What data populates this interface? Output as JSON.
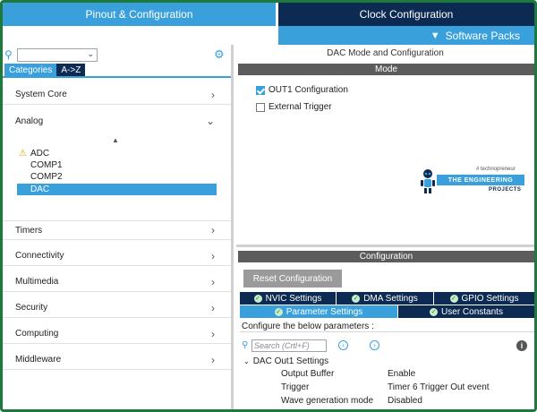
{
  "top_tabs": {
    "pinout": "Pinout & Configuration",
    "clock": "Clock Configuration"
  },
  "software_packs": {
    "label": "Software Packs",
    "chevron": "chevron-down-icon"
  },
  "left": {
    "search_value": "",
    "tabs": {
      "categories": "Categories",
      "az": "A->Z"
    },
    "categories": [
      {
        "label": "System Core",
        "expanded": false
      },
      {
        "label": "Analog",
        "expanded": true
      },
      {
        "label": "Timers",
        "expanded": false
      },
      {
        "label": "Connectivity",
        "expanded": false
      },
      {
        "label": "Multimedia",
        "expanded": false
      },
      {
        "label": "Security",
        "expanded": false
      },
      {
        "label": "Computing",
        "expanded": false
      },
      {
        "label": "Middleware",
        "expanded": false
      }
    ],
    "analog_items": [
      {
        "label": "ADC",
        "warning": true,
        "selected": false
      },
      {
        "label": "COMP1",
        "warning": false,
        "selected": false
      },
      {
        "label": "COMP2",
        "warning": false,
        "selected": false
      },
      {
        "label": "DAC",
        "warning": false,
        "selected": true
      }
    ]
  },
  "right": {
    "title": "DAC Mode and Configuration",
    "mode_band": "Mode",
    "mode_options": [
      {
        "label": "OUT1 Configuration",
        "checked": true
      },
      {
        "label": "External Trigger",
        "checked": false
      }
    ],
    "logo": {
      "tagline": "# technopreneur",
      "banner": "THE ENGINEERING",
      "subtitle": "PROJECTS"
    },
    "configuration_band": "Configuration",
    "reset_button": "Reset Configuration",
    "tabs_row1": [
      {
        "label": "NVIC Settings"
      },
      {
        "label": "DMA Settings"
      },
      {
        "label": "GPIO Settings"
      }
    ],
    "tabs_row2": [
      {
        "label": "Parameter Settings",
        "active": true
      },
      {
        "label": "User Constants",
        "active": false
      }
    ],
    "configure_text": "Configure the below parameters :",
    "search_placeholder": "Search (Crtl+F)",
    "group_title": "DAC Out1 Settings",
    "params": [
      {
        "name": "Output Buffer",
        "value": "Enable"
      },
      {
        "name": "Trigger",
        "value": "Timer 6 Trigger Out event"
      },
      {
        "name": "Wave generation mode",
        "value": "Disabled"
      }
    ]
  },
  "colors": {
    "accent": "#3aa0dc",
    "navy": "#0c2a52",
    "frame": "#1e7a3c",
    "band": "#5c5c5c"
  }
}
